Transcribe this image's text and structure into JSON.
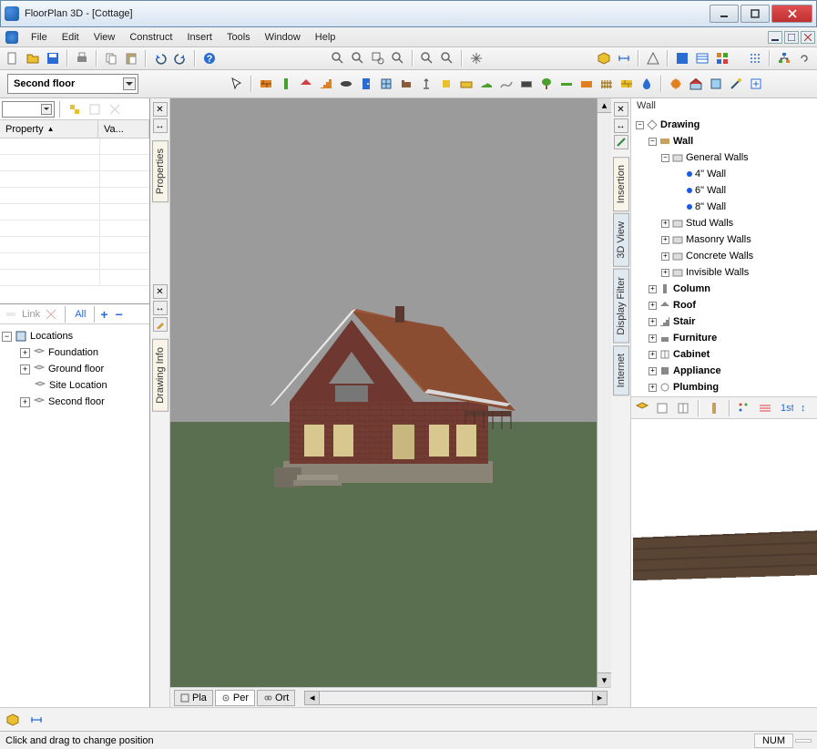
{
  "title": "FloorPlan 3D - [Cottage]",
  "menu": [
    "File",
    "Edit",
    "View",
    "Construct",
    "Insert",
    "Tools",
    "Window",
    "Help"
  ],
  "floor_selected": "Second floor",
  "property_panel": {
    "col1": "Property",
    "col2": "Va..."
  },
  "locations_tree": {
    "root": "Locations",
    "items": [
      "Foundation",
      "Ground floor",
      "Site Location",
      "Second floor"
    ]
  },
  "left_gutter_tabs_top": [
    "Properties"
  ],
  "left_gutter_tabs_bot": [
    "Drawing Info"
  ],
  "right_gutter_tabs": [
    "Insertion",
    "3D View",
    "Display Filter",
    "Internet"
  ],
  "left_bot_tools": {
    "link": "Link",
    "all": "All"
  },
  "right_label": "Wall",
  "catalog_tree": {
    "drawing": "Drawing",
    "wall": "Wall",
    "general_walls": "General Walls",
    "walls": [
      "4\" Wall",
      "6\" Wall",
      "8\" Wall"
    ],
    "stud": "Stud Walls",
    "masonry": "Masonry Walls",
    "concrete": "Concrete Walls",
    "invisible": "Invisible Walls",
    "column": "Column",
    "roof": "Roof",
    "stair": "Stair",
    "furniture": "Furniture",
    "cabinet": "Cabinet",
    "appliance": "Appliance",
    "plumbing": "Plumbing"
  },
  "view_tabs": {
    "plan": "Pla",
    "persp": "Per",
    "orth": "Ort"
  },
  "status_text": "Click and drag to change position",
  "status_num": "NUM"
}
